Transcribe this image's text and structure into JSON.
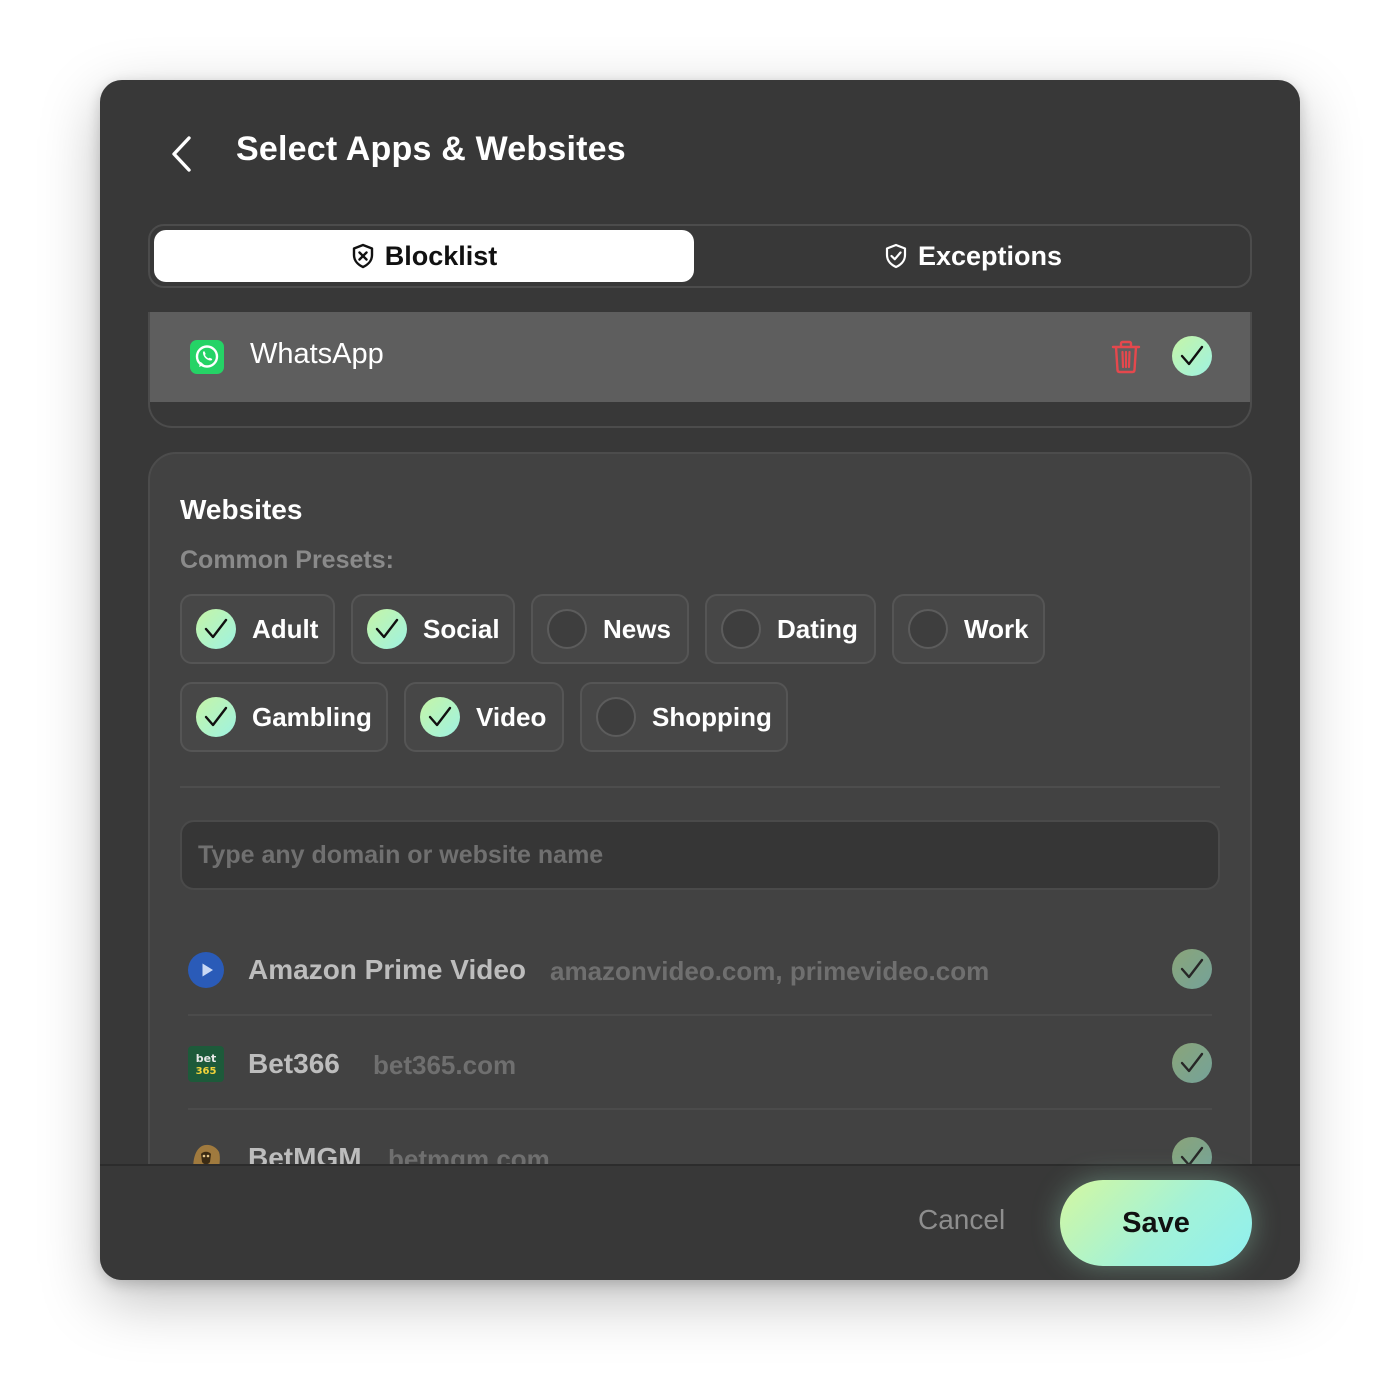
{
  "header": {
    "title": "Select Apps & Websites"
  },
  "tabs": [
    {
      "label": "Blocklist",
      "active": true,
      "icon": "shield-x-icon"
    },
    {
      "label": "Exceptions",
      "active": false,
      "icon": "shield-check-icon"
    }
  ],
  "apps": [
    {
      "name": "WhatsApp",
      "icon": "whatsapp-icon",
      "selected": true
    }
  ],
  "websites": {
    "title": "Websites",
    "presets_label": "Common Presets:",
    "presets": [
      {
        "label": "Adult",
        "checked": true
      },
      {
        "label": "Social",
        "checked": true
      },
      {
        "label": "News",
        "checked": false
      },
      {
        "label": "Dating",
        "checked": false
      },
      {
        "label": "Work",
        "checked": false
      },
      {
        "label": "Gambling",
        "checked": true
      },
      {
        "label": "Video",
        "checked": true
      },
      {
        "label": "Shopping",
        "checked": false
      }
    ],
    "search_placeholder": "Type any domain or website name",
    "sites": [
      {
        "name": "Amazon Prime Video",
        "domain": "amazonvideo.com, primevideo.com",
        "icon": "prime-video-icon",
        "checked": true
      },
      {
        "name": "Bet366",
        "domain": "bet365.com",
        "icon": "bet365-logo-icon",
        "checked": true
      },
      {
        "name": "BetMGM",
        "domain": "betmgm.com",
        "icon": "betmgm-lion-icon",
        "checked": true
      }
    ]
  },
  "footer": {
    "cancel_label": "Cancel",
    "save_label": "Save"
  },
  "colors": {
    "window_bg": "#383838",
    "card_bg": "#424242",
    "accent_start": "#c6f5a6",
    "accent_end": "#9ef2e2",
    "trash": "#e5484d",
    "whatsapp": "#25d366"
  }
}
